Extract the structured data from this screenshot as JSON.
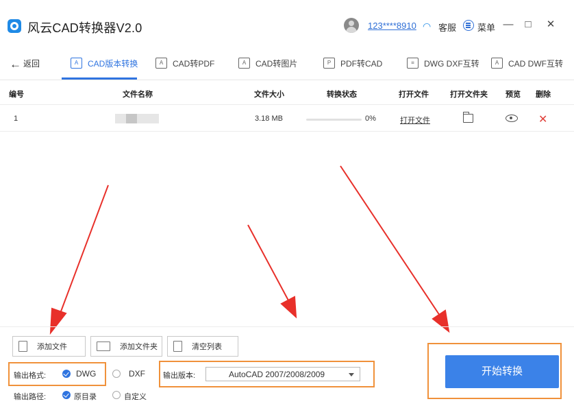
{
  "window": {
    "title": "风云CAD转换器V2.0",
    "user_id": "123****8910",
    "service_label": "客服",
    "menu_label": "菜单",
    "minimize": "—",
    "maximize": "□",
    "close": "✕"
  },
  "nav": {
    "back_label": "返回",
    "tabs": [
      {
        "label": "CAD版本转换",
        "icon": "cad-version-icon",
        "active": true
      },
      {
        "label": "CAD转PDF",
        "icon": "cad-pdf-icon"
      },
      {
        "label": "CAD转图片",
        "icon": "cad-image-icon"
      },
      {
        "label": "PDF转CAD",
        "icon": "pdf-cad-icon"
      },
      {
        "label": "DWG DXF互转",
        "icon": "dwg-dxf-icon"
      },
      {
        "label": "CAD DWF互转",
        "icon": "cad-dwf-icon"
      }
    ]
  },
  "table": {
    "headers": {
      "index": "编号",
      "name": "文件名称",
      "size": "文件大小",
      "status": "转换状态",
      "open_file": "打开文件",
      "open_folder": "打开文件夹",
      "preview": "预览",
      "delete": "删除"
    },
    "rows": [
      {
        "index": "1",
        "size": "3.18 MB",
        "progress": 0,
        "status_text": "0%",
        "open_file": "打开文件"
      }
    ]
  },
  "toolbar": {
    "add_file": "添加文件",
    "add_folder": "添加文件夹",
    "clear_list": "清空列表"
  },
  "options": {
    "format_label": "输出格式:",
    "format_options": [
      "DWG",
      "DXF"
    ],
    "format_selected": "DWG",
    "version_label": "输出版本:",
    "version_value": "AutoCAD 2007/2008/2009",
    "path_label": "输出路径:",
    "path_options": [
      "原目录",
      "自定义"
    ],
    "path_selected": "原目录"
  },
  "start_button": "开始转换",
  "colors": {
    "accent": "#2f74e0",
    "start_button": "#3b82e8",
    "annotation_arrow": "#e8302a",
    "annotation_box": "#f0913a",
    "delete": "#e0403a"
  }
}
